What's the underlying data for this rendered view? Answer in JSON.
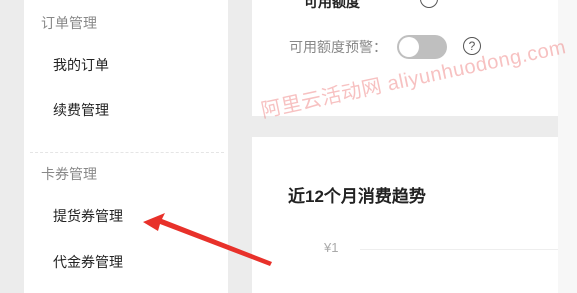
{
  "sidebar": {
    "order_group_title": "订单管理",
    "items_order": [
      {
        "label": "我的订单"
      },
      {
        "label": "续费管理"
      }
    ],
    "coupon_group_title": "卡券管理",
    "items_coupon": [
      {
        "label": "提货券管理"
      },
      {
        "label": "代金券管理"
      }
    ]
  },
  "top_card": {
    "cut_off_label": "可用额度",
    "alert_label": "可用额度预警：",
    "alert_toggle_on": false
  },
  "chart_card": {
    "title": "近12个月消费趋势",
    "y_tick": "¥1"
  },
  "watermark": "阿里云活动网 aliyunhuodong.com",
  "colors": {
    "arrow": "#e8312a",
    "watermark": "#e84d4d"
  }
}
